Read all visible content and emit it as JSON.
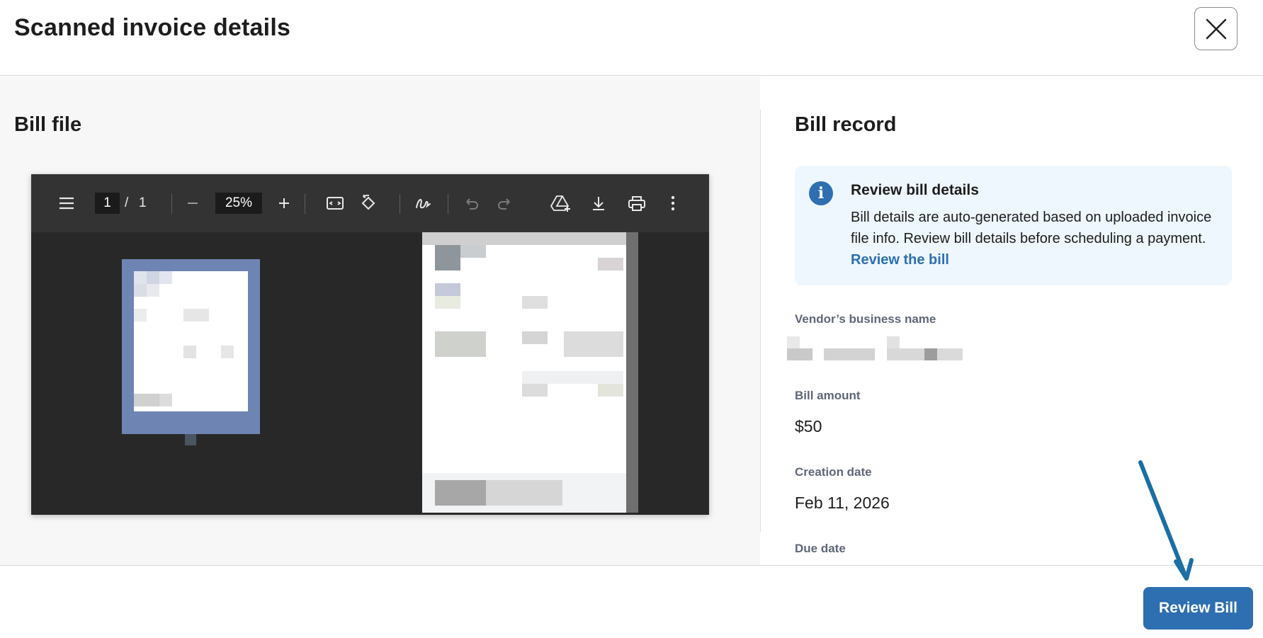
{
  "header": {
    "title": "Scanned invoice details",
    "close_icon": "close-icon"
  },
  "left": {
    "title": "Bill file"
  },
  "viewer": {
    "page_current": "1",
    "page_separator": "/",
    "page_total": "1",
    "zoom": "25%",
    "icons": [
      "menu-icon",
      "zoom-out-icon",
      "zoom-in-icon",
      "fit-to-page-icon",
      "rotate-icon",
      "annotate-icon",
      "undo-icon",
      "redo-icon",
      "save-to-drive-icon",
      "download-icon",
      "print-icon",
      "more-options-icon"
    ]
  },
  "right": {
    "title": "Bill record",
    "info": {
      "title": "Review bill details",
      "text": "Bill details are auto-generated based on uploaded invoice file info. Review bill details before scheduling a payment.",
      "link": "Review the bill"
    },
    "fields": {
      "vendor_label": "Vendor’s business name",
      "amount_label": "Bill amount",
      "amount_value": "$50",
      "creation_label": "Creation date",
      "creation_value": "Feb 11, 2026",
      "due_label": "Due date"
    }
  },
  "footer": {
    "review_button": "Review Bill"
  },
  "colors": {
    "accent": "#2d6fb0",
    "annotation_arrow": "#1a6fa3"
  }
}
